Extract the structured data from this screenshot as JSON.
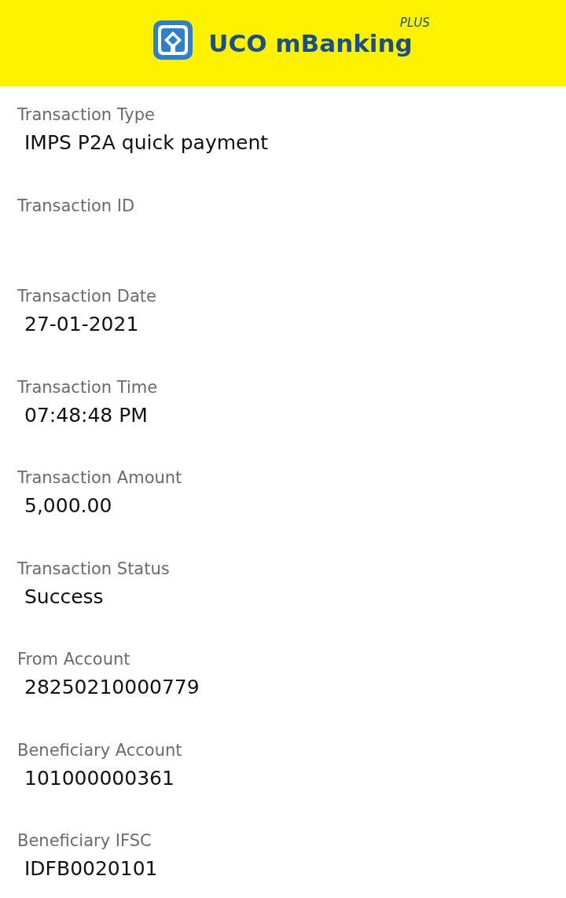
{
  "header": {
    "title": "UCO mBanking",
    "superscript": "PLUS"
  },
  "fields": [
    {
      "label": "Transaction Type",
      "value": "IMPS P2A quick payment"
    },
    {
      "label": "Transaction ID"
    },
    {
      "label": "Transaction Date",
      "value": "27-01-2021"
    },
    {
      "label": "Transaction Time",
      "value": "07:48:48 PM"
    },
    {
      "label": "Transaction Amount",
      "value": "5,000.00"
    },
    {
      "label": "Transaction Status",
      "value": "Success"
    },
    {
      "label": "From Account",
      "value": "28250210000779"
    },
    {
      "label": "Beneficiary Account",
      "value": "101000000361"
    },
    {
      "label": "Beneficiary IFSC",
      "value": "IDFB0020101"
    }
  ]
}
